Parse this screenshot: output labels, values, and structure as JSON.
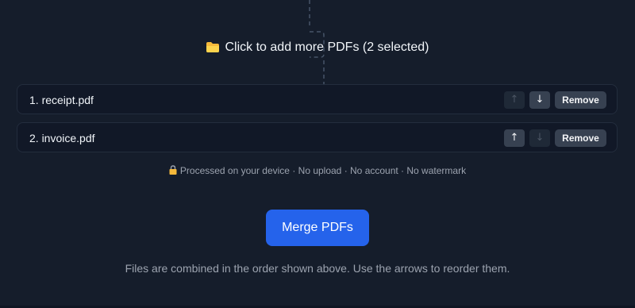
{
  "dropzone": {
    "icon": "folder-icon",
    "label": "Click to add more PDFs (2 selected)"
  },
  "files": [
    {
      "name": "1. receipt.pdf",
      "up_label": "↑",
      "down_label": "↓",
      "up_enabled": false,
      "down_enabled": true,
      "remove_label": "Remove"
    },
    {
      "name": "2. invoice.pdf",
      "up_label": "↑",
      "down_label": "↓",
      "up_enabled": true,
      "down_enabled": false,
      "remove_label": "Remove"
    }
  ],
  "privacy": {
    "icon": "lock-icon",
    "text": "Processed on your device · No upload · No account · No watermark"
  },
  "merge_button": {
    "label": "Merge PDFs"
  },
  "footer": {
    "text": "Files are combined in the order shown above. Use the arrows to reorder them."
  },
  "colors": {
    "background": "#151d2b",
    "row_background": "#111827",
    "button_gray": "#374151",
    "accent": "#2563eb",
    "muted_text": "#9ca3af"
  }
}
